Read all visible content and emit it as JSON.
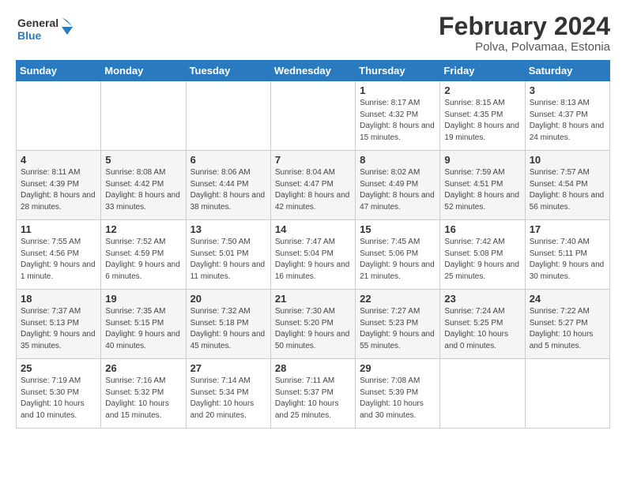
{
  "header": {
    "logo_general": "General",
    "logo_blue": "Blue",
    "month_year": "February 2024",
    "location": "Polva, Polvamaa, Estonia"
  },
  "weekdays": [
    "Sunday",
    "Monday",
    "Tuesday",
    "Wednesday",
    "Thursday",
    "Friday",
    "Saturday"
  ],
  "weeks": [
    [
      {
        "day": "",
        "detail": ""
      },
      {
        "day": "",
        "detail": ""
      },
      {
        "day": "",
        "detail": ""
      },
      {
        "day": "",
        "detail": ""
      },
      {
        "day": "1",
        "detail": "Sunrise: 8:17 AM\nSunset: 4:32 PM\nDaylight: 8 hours\nand 15 minutes."
      },
      {
        "day": "2",
        "detail": "Sunrise: 8:15 AM\nSunset: 4:35 PM\nDaylight: 8 hours\nand 19 minutes."
      },
      {
        "day": "3",
        "detail": "Sunrise: 8:13 AM\nSunset: 4:37 PM\nDaylight: 8 hours\nand 24 minutes."
      }
    ],
    [
      {
        "day": "4",
        "detail": "Sunrise: 8:11 AM\nSunset: 4:39 PM\nDaylight: 8 hours\nand 28 minutes."
      },
      {
        "day": "5",
        "detail": "Sunrise: 8:08 AM\nSunset: 4:42 PM\nDaylight: 8 hours\nand 33 minutes."
      },
      {
        "day": "6",
        "detail": "Sunrise: 8:06 AM\nSunset: 4:44 PM\nDaylight: 8 hours\nand 38 minutes."
      },
      {
        "day": "7",
        "detail": "Sunrise: 8:04 AM\nSunset: 4:47 PM\nDaylight: 8 hours\nand 42 minutes."
      },
      {
        "day": "8",
        "detail": "Sunrise: 8:02 AM\nSunset: 4:49 PM\nDaylight: 8 hours\nand 47 minutes."
      },
      {
        "day": "9",
        "detail": "Sunrise: 7:59 AM\nSunset: 4:51 PM\nDaylight: 8 hours\nand 52 minutes."
      },
      {
        "day": "10",
        "detail": "Sunrise: 7:57 AM\nSunset: 4:54 PM\nDaylight: 8 hours\nand 56 minutes."
      }
    ],
    [
      {
        "day": "11",
        "detail": "Sunrise: 7:55 AM\nSunset: 4:56 PM\nDaylight: 9 hours\nand 1 minute."
      },
      {
        "day": "12",
        "detail": "Sunrise: 7:52 AM\nSunset: 4:59 PM\nDaylight: 9 hours\nand 6 minutes."
      },
      {
        "day": "13",
        "detail": "Sunrise: 7:50 AM\nSunset: 5:01 PM\nDaylight: 9 hours\nand 11 minutes."
      },
      {
        "day": "14",
        "detail": "Sunrise: 7:47 AM\nSunset: 5:04 PM\nDaylight: 9 hours\nand 16 minutes."
      },
      {
        "day": "15",
        "detail": "Sunrise: 7:45 AM\nSunset: 5:06 PM\nDaylight: 9 hours\nand 21 minutes."
      },
      {
        "day": "16",
        "detail": "Sunrise: 7:42 AM\nSunset: 5:08 PM\nDaylight: 9 hours\nand 25 minutes."
      },
      {
        "day": "17",
        "detail": "Sunrise: 7:40 AM\nSunset: 5:11 PM\nDaylight: 9 hours\nand 30 minutes."
      }
    ],
    [
      {
        "day": "18",
        "detail": "Sunrise: 7:37 AM\nSunset: 5:13 PM\nDaylight: 9 hours\nand 35 minutes."
      },
      {
        "day": "19",
        "detail": "Sunrise: 7:35 AM\nSunset: 5:15 PM\nDaylight: 9 hours\nand 40 minutes."
      },
      {
        "day": "20",
        "detail": "Sunrise: 7:32 AM\nSunset: 5:18 PM\nDaylight: 9 hours\nand 45 minutes."
      },
      {
        "day": "21",
        "detail": "Sunrise: 7:30 AM\nSunset: 5:20 PM\nDaylight: 9 hours\nand 50 minutes."
      },
      {
        "day": "22",
        "detail": "Sunrise: 7:27 AM\nSunset: 5:23 PM\nDaylight: 9 hours\nand 55 minutes."
      },
      {
        "day": "23",
        "detail": "Sunrise: 7:24 AM\nSunset: 5:25 PM\nDaylight: 10 hours\nand 0 minutes."
      },
      {
        "day": "24",
        "detail": "Sunrise: 7:22 AM\nSunset: 5:27 PM\nDaylight: 10 hours\nand 5 minutes."
      }
    ],
    [
      {
        "day": "25",
        "detail": "Sunrise: 7:19 AM\nSunset: 5:30 PM\nDaylight: 10 hours\nand 10 minutes."
      },
      {
        "day": "26",
        "detail": "Sunrise: 7:16 AM\nSunset: 5:32 PM\nDaylight: 10 hours\nand 15 minutes."
      },
      {
        "day": "27",
        "detail": "Sunrise: 7:14 AM\nSunset: 5:34 PM\nDaylight: 10 hours\nand 20 minutes."
      },
      {
        "day": "28",
        "detail": "Sunrise: 7:11 AM\nSunset: 5:37 PM\nDaylight: 10 hours\nand 25 minutes."
      },
      {
        "day": "29",
        "detail": "Sunrise: 7:08 AM\nSunset: 5:39 PM\nDaylight: 10 hours\nand 30 minutes."
      },
      {
        "day": "",
        "detail": ""
      },
      {
        "day": "",
        "detail": ""
      }
    ]
  ]
}
